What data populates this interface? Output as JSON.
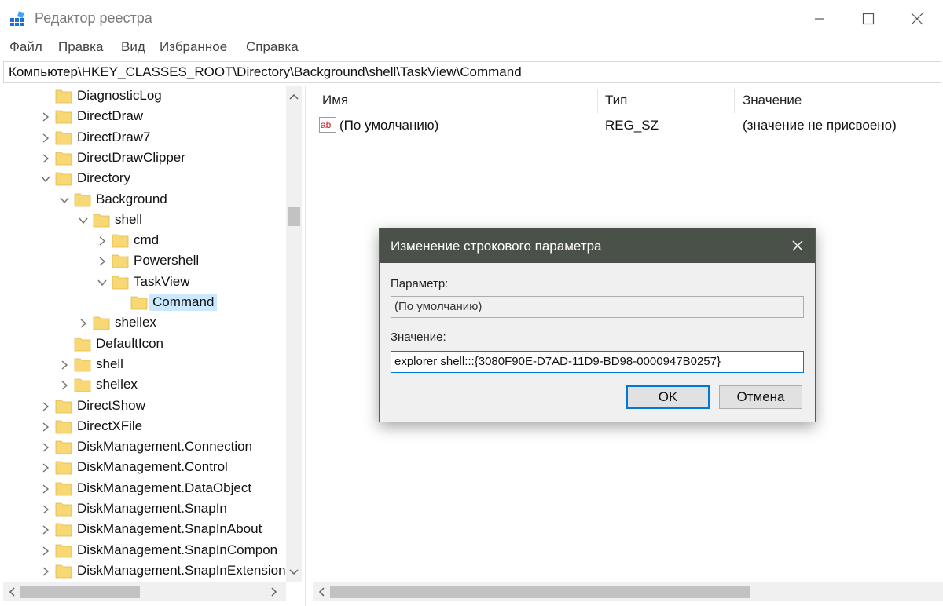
{
  "window": {
    "title": "Редактор реестра"
  },
  "menu": [
    "Файл",
    "Правка",
    "Вид",
    "Избранное",
    "Справка"
  ],
  "address": "Компьютер\\HKEY_CLASSES_ROOT\\Directory\\Background\\shell\\TaskView\\Command",
  "tree": [
    {
      "label": "DiagnosticLog",
      "level": 0,
      "arrow": "none"
    },
    {
      "label": "DirectDraw",
      "level": 0,
      "arrow": "right"
    },
    {
      "label": "DirectDraw7",
      "level": 0,
      "arrow": "right"
    },
    {
      "label": "DirectDrawClipper",
      "level": 0,
      "arrow": "right"
    },
    {
      "label": "Directory",
      "level": 0,
      "arrow": "down"
    },
    {
      "label": "Background",
      "level": 1,
      "arrow": "down"
    },
    {
      "label": "shell",
      "level": 2,
      "arrow": "down"
    },
    {
      "label": "cmd",
      "level": 3,
      "arrow": "right"
    },
    {
      "label": "Powershell",
      "level": 3,
      "arrow": "right"
    },
    {
      "label": "TaskView",
      "level": 3,
      "arrow": "down"
    },
    {
      "label": "Command",
      "level": 4,
      "arrow": "none",
      "selected": true
    },
    {
      "label": "shellex",
      "level": 2,
      "arrow": "right"
    },
    {
      "label": "DefaultIcon",
      "level": 1,
      "arrow": "none"
    },
    {
      "label": "shell",
      "level": 1,
      "arrow": "right"
    },
    {
      "label": "shellex",
      "level": 1,
      "arrow": "right"
    },
    {
      "label": "DirectShow",
      "level": 0,
      "arrow": "right"
    },
    {
      "label": "DirectXFile",
      "level": 0,
      "arrow": "right"
    },
    {
      "label": "DiskManagement.Connection",
      "level": 0,
      "arrow": "right"
    },
    {
      "label": "DiskManagement.Control",
      "level": 0,
      "arrow": "right"
    },
    {
      "label": "DiskManagement.DataObject",
      "level": 0,
      "arrow": "right"
    },
    {
      "label": "DiskManagement.SnapIn",
      "level": 0,
      "arrow": "right"
    },
    {
      "label": "DiskManagement.SnapInAbout",
      "level": 0,
      "arrow": "right"
    },
    {
      "label": "DiskManagement.SnapInCompon",
      "level": 0,
      "arrow": "right"
    },
    {
      "label": "DiskManagement.SnapInExtension",
      "level": 0,
      "arrow": "right"
    }
  ],
  "list": {
    "columns": [
      "Имя",
      "Тип",
      "Значение"
    ],
    "rows": [
      {
        "name": "(По умолчанию)",
        "type": "REG_SZ",
        "value": "(значение не присвоено)",
        "icon_text": "ab"
      }
    ]
  },
  "dialog": {
    "title": "Изменение строкового параметра",
    "param_label": "Параметр:",
    "param_value": "(По умолчанию)",
    "value_label": "Значение:",
    "value_text": "explorer shell:::{3080F90E-D7AD-11D9-BD98-0000947B0257}",
    "ok": "OK",
    "cancel": "Отмена"
  },
  "colors": {
    "accent": "#0078d7",
    "folder": "#f8d775",
    "dialog_title": "#4a5148",
    "selection": "#cce8ff"
  }
}
